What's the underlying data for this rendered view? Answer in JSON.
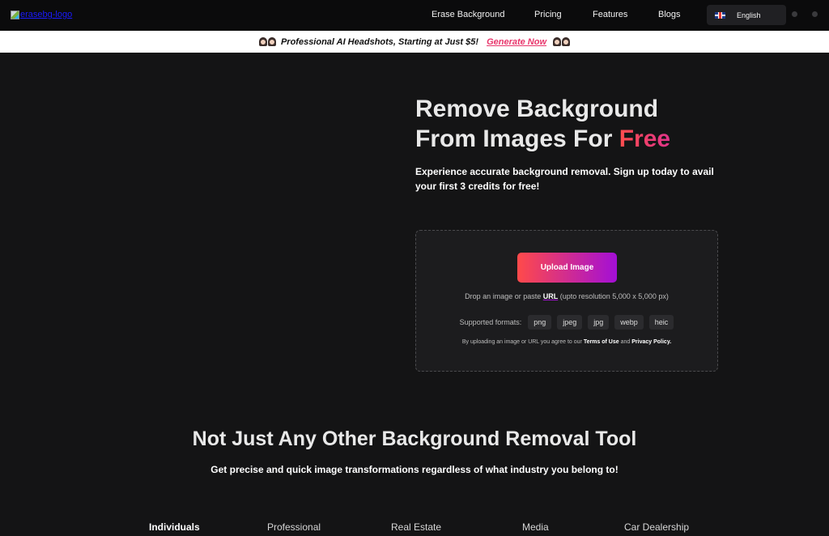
{
  "nav": {
    "logo_alt": "erasebg-logo",
    "links": [
      "Erase Background",
      "Pricing",
      "Features",
      "Blogs"
    ],
    "language": "English",
    "flag_icon": "uk-flag-icon"
  },
  "banner": {
    "text": "Professional AI Headshots, Starting at Just $5!",
    "cta": "Generate Now"
  },
  "hero": {
    "title_line1": "Remove Background",
    "title_line2_prefix": "From Images For ",
    "title_accent": "Free",
    "subtitle": "Experience accurate background removal. Sign up today to avail your first 3 credits for free!"
  },
  "upload": {
    "button_label": "Upload Image",
    "drop_prefix": "Drop an image or paste ",
    "drop_link": "URL",
    "drop_suffix": " (upto resolution 5,000 x 5,000 px)",
    "formats_label": "Supported formats:",
    "formats": [
      "png",
      "jpeg",
      "jpg",
      "webp",
      "heic"
    ],
    "terms_prefix": "By uploading an image or URL you agree to our ",
    "terms_link": "Terms of Use",
    "terms_and": " and ",
    "privacy_link": "Privacy Policy."
  },
  "section": {
    "title": "Not Just Any Other Background Removal Tool",
    "subtitle": "Get precise and quick image transformations regardless of what industry you belong to!",
    "tabs": [
      "Individuals",
      "Professional",
      "Real Estate",
      "Media",
      "Car Dealership"
    ],
    "active_tab": "Individuals"
  },
  "colors": {
    "background": "#141415",
    "accent_start": "#ff4a4a",
    "accent_end": "#a30fd6",
    "link_pink": "#e8356b"
  }
}
